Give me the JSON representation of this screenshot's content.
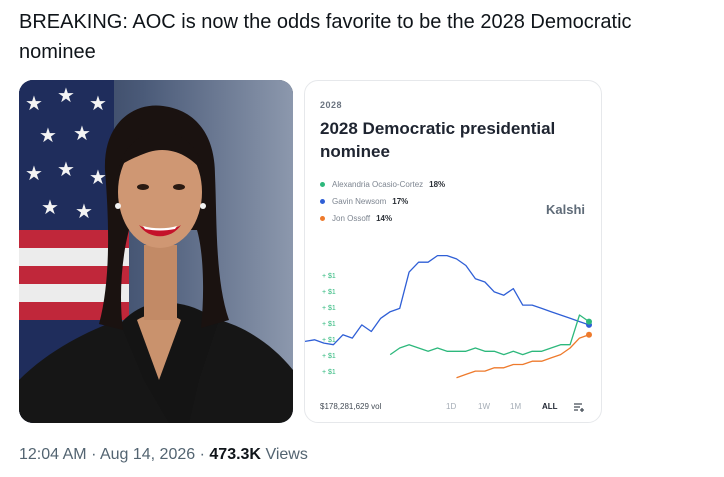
{
  "tweet": {
    "text": "BREAKING: AOC is now the odds favorite to be the 2028 Democratic nominee",
    "time": "12:04 AM",
    "separator": "·",
    "date": "Aug 14, 2026",
    "views_count": "473.3K",
    "views_label": "Views"
  },
  "card": {
    "kicker": "2028",
    "title": "2028 Democratic presidential nominee",
    "brand": "Kalshi",
    "legend": [
      {
        "name": "Alexandria Ocasio-Cortez",
        "pct": "18%",
        "color": "#2db87c"
      },
      {
        "name": "Gavin Newsom",
        "pct": "17%",
        "color": "#2f5fd6"
      },
      {
        "name": "Jon Ossoff",
        "pct": "14%",
        "color": "#ee7a2c"
      }
    ],
    "axis_ticks": [
      "+ $1",
      "+ $1",
      "+ $1",
      "+ $1",
      "+ $1",
      "+ $1",
      "+ $1"
    ],
    "volume": "$178,281,629 vol",
    "ranges": [
      "1D",
      "1W",
      "1M",
      "ALL"
    ],
    "active_range": "ALL"
  },
  "chart_data": {
    "type": "line",
    "title": "2028 Democratic presidential nominee",
    "xlabel": "",
    "ylabel": "",
    "grid": false,
    "legend_position": "top-left",
    "y_tick_labels": [
      "+ $1",
      "+ $1",
      "+ $1",
      "+ $1",
      "+ $1",
      "+ $1",
      "+ $1"
    ],
    "ylim": [
      0,
      40
    ],
    "x": [
      0,
      1,
      2,
      3,
      4,
      5,
      6,
      7,
      8,
      9,
      10,
      11,
      12,
      13,
      14,
      15,
      16,
      17,
      18,
      19,
      20,
      21,
      22,
      23,
      24,
      25,
      26,
      27,
      28,
      29,
      30
    ],
    "series": [
      {
        "name": "Gavin Newsom",
        "color": "#2f5fd6",
        "values": [
          12,
          12.5,
          11.5,
          11,
          14,
          13,
          17,
          15,
          19,
          21,
          22,
          33,
          36,
          36,
          38,
          38,
          37,
          35,
          31,
          30,
          27,
          26,
          28,
          23,
          23,
          22,
          21,
          20,
          19,
          18,
          17
        ]
      },
      {
        "name": "Alexandria Ocasio-Cortez",
        "color": "#2db87c",
        "values": [
          null,
          null,
          null,
          null,
          null,
          null,
          null,
          null,
          null,
          8,
          10,
          11,
          10,
          9,
          10,
          9,
          9,
          9,
          10,
          9,
          9,
          8,
          9,
          8,
          9,
          9,
          10,
          11,
          11,
          20,
          18
        ]
      },
      {
        "name": "Jon Ossoff",
        "color": "#ee7a2c",
        "values": [
          null,
          null,
          null,
          null,
          null,
          null,
          null,
          null,
          null,
          null,
          null,
          null,
          null,
          null,
          null,
          null,
          1,
          2,
          3,
          3,
          4,
          4,
          5,
          5,
          6,
          6,
          7,
          8,
          10,
          13,
          14
        ]
      }
    ]
  }
}
